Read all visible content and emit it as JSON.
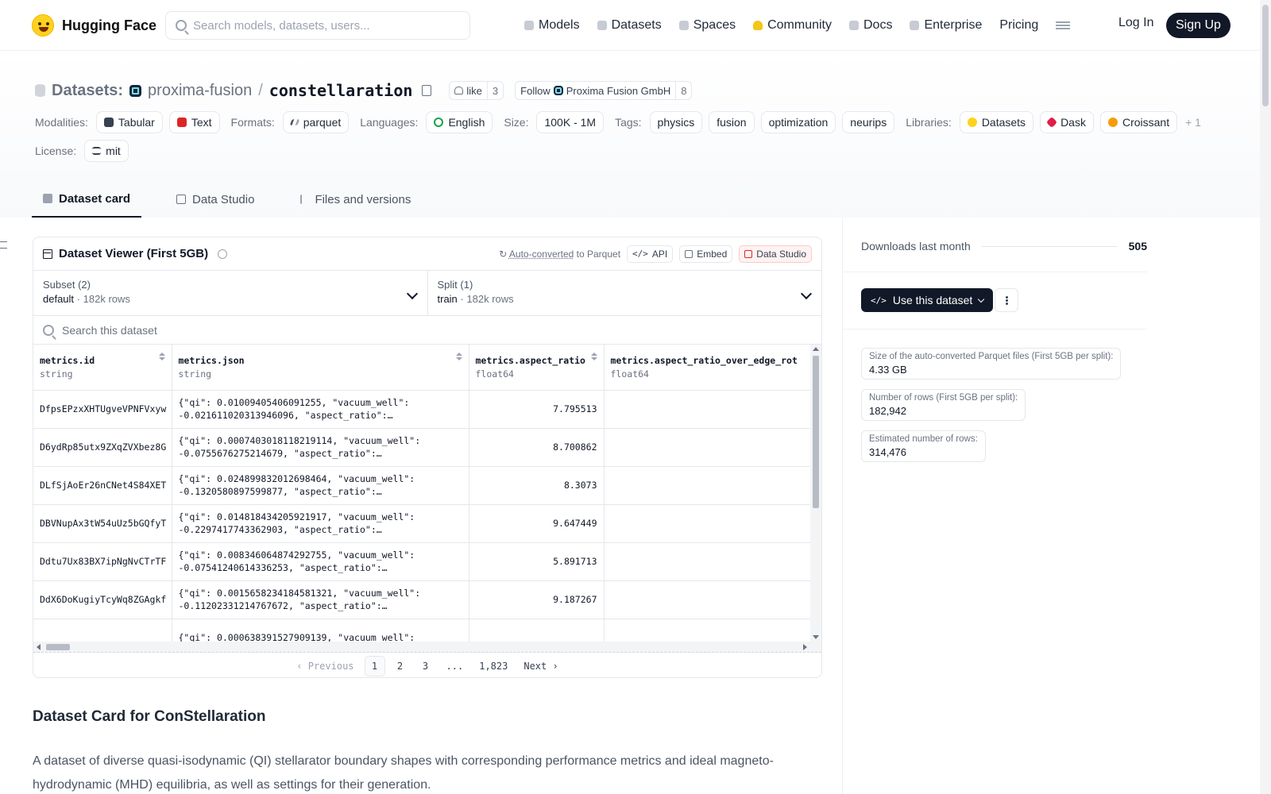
{
  "nav": {
    "brand": "Hugging Face",
    "search_placeholder": "Search models, datasets, users...",
    "links": [
      "Models",
      "Datasets",
      "Spaces",
      "Community",
      "Docs",
      "Enterprise",
      "Pricing"
    ],
    "login": "Log In",
    "signup": "Sign Up"
  },
  "header": {
    "section": "Datasets:",
    "org": "proxima-fusion",
    "repo": "constellaration",
    "like_label": "like",
    "like_count": "3",
    "follow_label": "Follow",
    "follow_org": "Proxima Fusion GmbH",
    "follow_count": "8"
  },
  "meta": {
    "modalities_key": "Modalities:",
    "modalities": [
      "Tabular",
      "Text"
    ],
    "formats_key": "Formats:",
    "format": "parquet",
    "languages_key": "Languages:",
    "language": "English",
    "size_key": "Size:",
    "size": "100K - 1M",
    "tags_key": "Tags:",
    "tags": [
      "physics",
      "fusion",
      "optimization",
      "neurips"
    ],
    "libraries_key": "Libraries:",
    "libraries": [
      "Datasets",
      "Dask",
      "Croissant"
    ],
    "libraries_more": "+ 1",
    "license_key": "License:",
    "license": "mit"
  },
  "tabs": [
    "Dataset card",
    "Data Studio",
    "Files and versions"
  ],
  "viewer": {
    "title": "Dataset Viewer (First 5GB)",
    "auto_converted": "Auto-converted",
    "to_parquet": "to Parquet",
    "api": "API",
    "embed": "Embed",
    "data_studio": "Data Studio",
    "subset_label": "Subset (2)",
    "subset_value": "default",
    "subset_rows": "182k rows",
    "split_label": "Split (1)",
    "split_value": "train",
    "split_rows": "182k rows",
    "search_placeholder": "Search this dataset",
    "columns": [
      {
        "name": "metrics.id",
        "type": "string"
      },
      {
        "name": "metrics.json",
        "type": "string"
      },
      {
        "name": "metrics.aspect_ratio",
        "type": "float64"
      },
      {
        "name": "metrics.aspect_ratio_over_edge_rot",
        "type": "float64"
      }
    ],
    "rows": [
      {
        "id": "DfpsEPzxXHTUgveVPNFVxyw",
        "json1": "{\"qi\": 0.01009405406091255, \"vacuum_well\":",
        "json2": "-0.021611020313946096, \"aspect_ratio\":…",
        "ar": "7.795513"
      },
      {
        "id": "D6ydRp85utx9ZXqZVXbez8G",
        "json1": "{\"qi\": 0.0007403018118219114, \"vacuum_well\":",
        "json2": "-0.0755676275214679, \"aspect_ratio\":…",
        "ar": "8.700862"
      },
      {
        "id": "DLfSjAoEr26nCNet4S84XET",
        "json1": "{\"qi\": 0.024899832012698464, \"vacuum_well\":",
        "json2": "-0.1320580897599877, \"aspect_ratio\":…",
        "ar": "8.3073"
      },
      {
        "id": "DBVNupAx3tW54uUz5bGQfyT",
        "json1": "{\"qi\": 0.014818434205921917, \"vacuum_well\":",
        "json2": "-0.2297417743362903, \"aspect_ratio\":…",
        "ar": "9.647449"
      },
      {
        "id": "Ddtu7Ux83BX7ipNgNvCTrTF",
        "json1": "{\"qi\": 0.008346064874292755, \"vacuum_well\":",
        "json2": "-0.07541240614336253, \"aspect_ratio\":…",
        "ar": "5.891713"
      },
      {
        "id": "DdX6DoKugiyTcyWq8ZGAgkf",
        "json1": "{\"qi\": 0.0015658234184581321, \"vacuum_well\":",
        "json2": "-0.11202331214767672, \"aspect_ratio\":…",
        "ar": "9.187267"
      },
      {
        "id": "",
        "json1": "{\"qi\": 0.000638391527909139, \"vacuum_well\":",
        "json2": "",
        "ar": ""
      }
    ],
    "pager": {
      "previous": "Previous",
      "pages": [
        "1",
        "2",
        "3",
        "...",
        "1,823"
      ],
      "next": "Next"
    }
  },
  "sidebar": {
    "downloads_label": "Downloads last month",
    "downloads_value": "505",
    "use_button": "Use this dataset",
    "stats": [
      {
        "label": "Size of the auto-converted Parquet files (First 5GB per split):",
        "value": "4.33 GB"
      },
      {
        "label": "Number of rows (First 5GB per split):",
        "value": "182,942"
      },
      {
        "label": "Estimated number of rows:",
        "value": "314,476"
      }
    ]
  },
  "card": {
    "title": "Dataset Card for ConStellaration",
    "description": "A dataset of diverse quasi-isodynamic (QI) stellarator boundary shapes with corresponding performance metrics and ideal magneto-hydrodynamic (MHD) equilibria, as well as settings for their generation."
  }
}
